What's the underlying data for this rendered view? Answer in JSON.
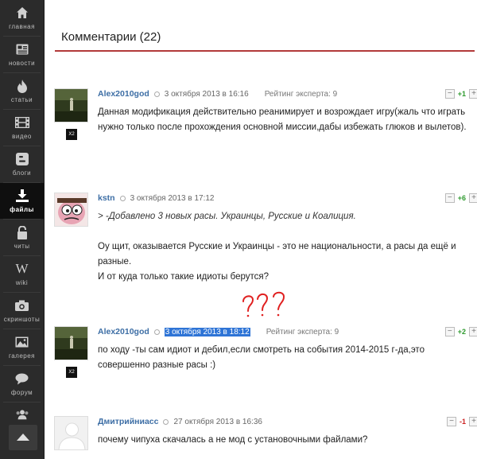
{
  "sidebar": {
    "items": [
      {
        "label": "главная",
        "icon": "home-icon"
      },
      {
        "label": "новости",
        "icon": "news-icon"
      },
      {
        "label": "статьи",
        "icon": "fire-icon"
      },
      {
        "label": "видео",
        "icon": "film-icon"
      },
      {
        "label": "блоги",
        "icon": "blogger-icon"
      },
      {
        "label": "файлы",
        "icon": "download-icon",
        "active": true
      },
      {
        "label": "читы",
        "icon": "unlock-icon"
      },
      {
        "label": "wiki",
        "icon": "wiki-icon"
      },
      {
        "label": "скриншоты",
        "icon": "camera-icon"
      },
      {
        "label": "галерея",
        "icon": "picture-icon"
      },
      {
        "label": "форум",
        "icon": "chat-icon"
      }
    ],
    "wiki_glyph": "W"
  },
  "comments_section": {
    "title": "Комментарии (22)"
  },
  "comments": [
    {
      "author": "Alex2010god",
      "date": "3 октября 2013 в 16:16",
      "rating": "Рейтинг эксперта: 9",
      "score": "+1",
      "badge": "X2",
      "text": "Данная модификация действительно реанимирует и возрождает игру(жаль что играть нужно только после прохождения основной миссии,дабы избежать глюков и вылетов)."
    },
    {
      "author": "kstn",
      "date": "3 октября 2013 в 17:12",
      "score": "+6",
      "quote": "> -Добавлено 3 новых расы. Украинцы, Русские и Коалиция.",
      "line1": "Оу щит, оказывается Русские и Украинцы - это не национальности, а расы да ещё и разные.",
      "line2": "И от куда только такие идиоты берутся?"
    },
    {
      "author": "Alex2010god",
      "date": "3 октября 2013 в 18:12",
      "rating": "Рейтинг эксперта: 9",
      "score": "+2",
      "badge": "X2",
      "text": "по ходу -ты сам идиот и дебил,если смотреть на события 2014-2015 г-да,это совершенно разные расы :)"
    },
    {
      "author": "Дмитрийниасс",
      "date": "27 октября 2013 в 16:36",
      "score": "-1",
      "text": "почему чипуха скачалась а не мод с установочными файлами?"
    }
  ],
  "vote": {
    "minus": "−",
    "plus": "+"
  },
  "annotation": "???",
  "colors": {
    "accent": "#b23a3a",
    "link": "#3d6ea5",
    "positive": "#2e9a2e",
    "negative": "#cc2222",
    "highlight": "#2e74d6"
  }
}
